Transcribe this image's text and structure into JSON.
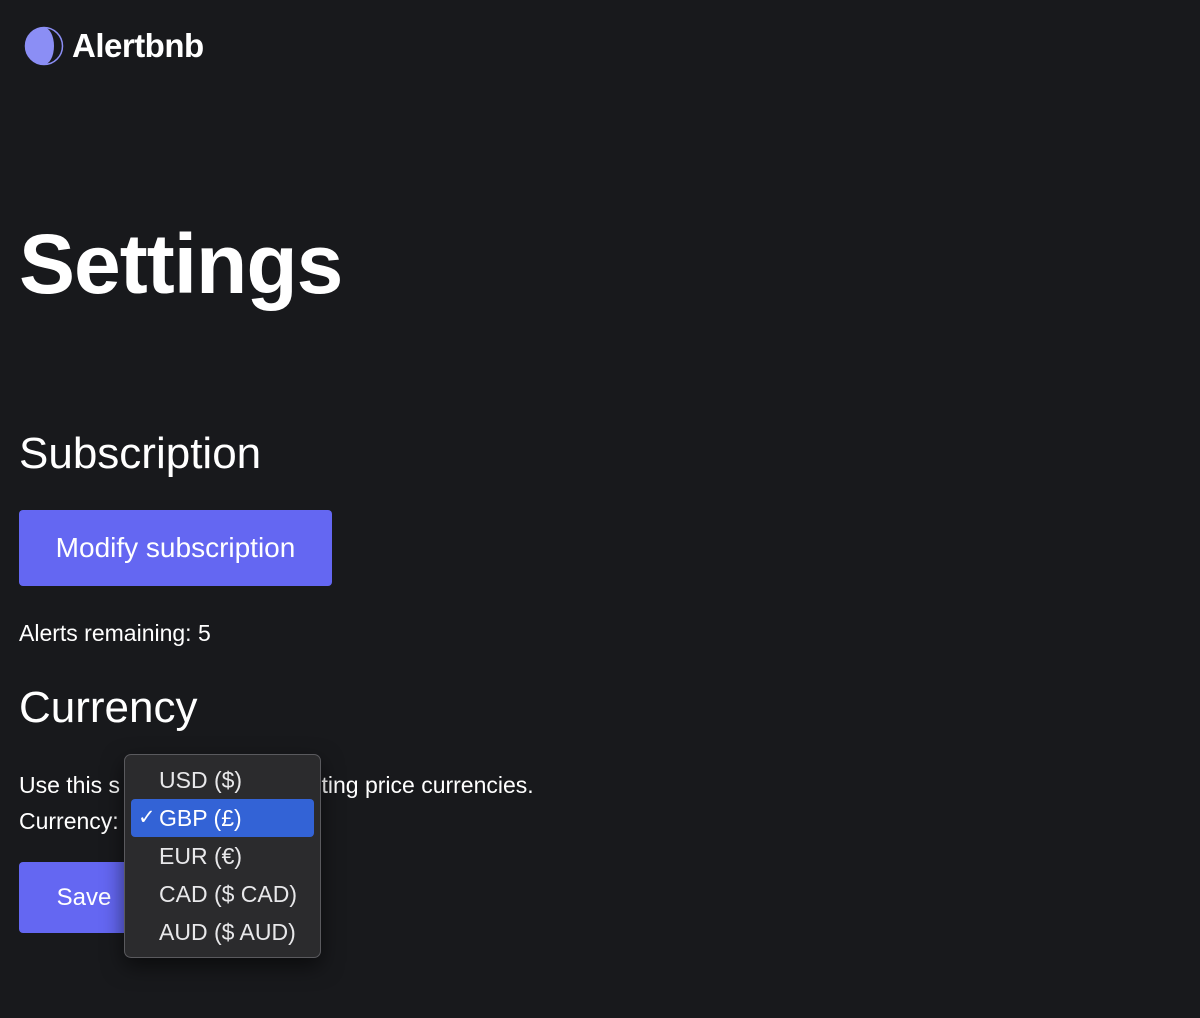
{
  "brand": {
    "name": "Alertbnb",
    "logo_icon": "half-moon-icon",
    "logo_color": "#8b8ef5"
  },
  "page_title": "Settings",
  "subscription": {
    "heading": "Subscription",
    "modify_button_label": "Modify subscription",
    "alerts_remaining_text": "Alerts remaining: 5"
  },
  "currency": {
    "heading": "Currency",
    "description_visible_start": "Use this s",
    "description_visible_end": "sting price currencies.",
    "field_label": "Currency:",
    "selected_value": "GBP (£)",
    "options": [
      {
        "label": "USD ($)"
      },
      {
        "label": "GBP (£)"
      },
      {
        "label": "EUR (€)"
      },
      {
        "label": "CAD ($ CAD)"
      },
      {
        "label": "AUD ($ AUD)"
      }
    ],
    "check_glyph": "✓"
  },
  "save_button_label": "Save",
  "colors": {
    "background": "#18191c",
    "accent": "#6467f2",
    "selection": "#3363d6"
  }
}
